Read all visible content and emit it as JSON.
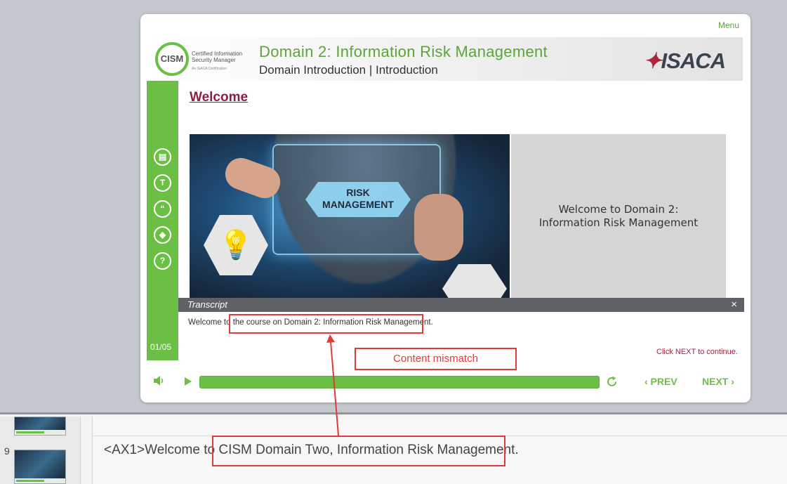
{
  "player": {
    "menu_label": "Menu",
    "cism_logo_text": "CISM",
    "cism_tagline_1": "Certified Information",
    "cism_tagline_2": "Security Manager",
    "cism_subtag": "An ISACA Certification",
    "title": "Domain 2: Information Risk Management",
    "subtitle": "Domain Introduction | Introduction",
    "brand_logo": "ISACA",
    "slide_heading": "Welcome",
    "hero_label_1": "RISK",
    "hero_label_2": "MANAGEMENT",
    "info_line_1": "Welcome to Domain 2:",
    "info_line_2": "Information Risk Management",
    "page_counter": "01/05",
    "sidebar_icons": [
      "notes-icon",
      "glossary-icon",
      "quote-icon",
      "layers-icon",
      "help-icon"
    ],
    "sidebar_glyphs": [
      "▤",
      "T",
      "“",
      "◈",
      "?"
    ]
  },
  "transcript": {
    "title": "Transcript",
    "close": "×",
    "text": "Welcome to the course on Domain 2: Information Risk Management."
  },
  "controls": {
    "click_next": "Click NEXT to continue.",
    "prev_label": "‹  PREV",
    "next_label": "NEXT  ›",
    "progress": 1.0
  },
  "annotation": {
    "label": "Content mismatch",
    "color": "#e03b3b"
  },
  "editor": {
    "slide_number": "9",
    "audio_text": "<AX1>Welcome to CISM Domain Two, Information Risk Management."
  },
  "colors": {
    "accent_green": "#6cbf45",
    "heading_maroon": "#8c1f3f"
  }
}
